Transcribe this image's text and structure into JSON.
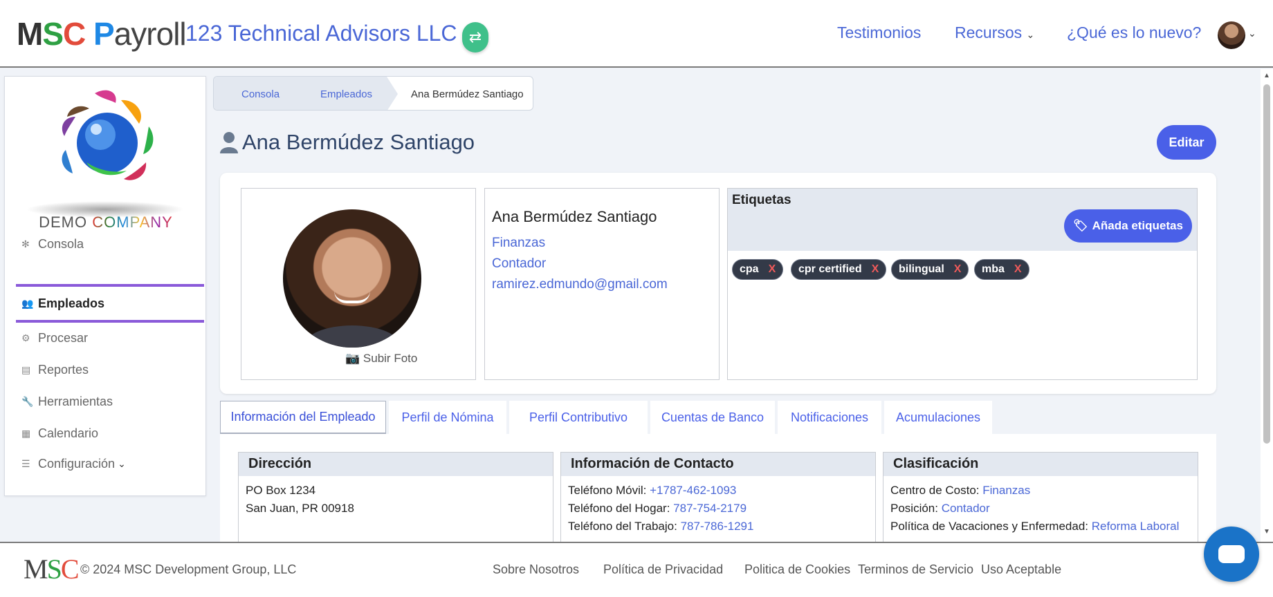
{
  "header": {
    "company": "123 Technical Advisors LLC",
    "nav": [
      {
        "label": "Testimonios"
      },
      {
        "label": "Recursos"
      },
      {
        "label": "¿Qué es lo nuevo?"
      }
    ]
  },
  "brand": {
    "logo_parts": [
      "M",
      "S",
      "C",
      "P",
      "ayroll"
    ],
    "demo_word1": "DEMO",
    "demo_word2": "COMPANY"
  },
  "sidebar": {
    "items": [
      {
        "label": "Consola",
        "icon": "gear-icon"
      },
      {
        "label": "Empleados",
        "icon": "users-icon"
      },
      {
        "label": "Procesar",
        "icon": "cogs-icon"
      },
      {
        "label": "Reportes",
        "icon": "printer-icon"
      },
      {
        "label": "Herramientas",
        "icon": "wrench-icon"
      },
      {
        "label": "Calendario",
        "icon": "calendar-icon"
      },
      {
        "label": "Configuración",
        "icon": "sliders-icon"
      }
    ]
  },
  "breadcrumb": {
    "items": [
      "Consola",
      "Empleados",
      "Ana Bermúdez Santiago"
    ]
  },
  "page": {
    "title": "Ana Bermúdez Santiago",
    "edit_label": "Editar"
  },
  "employee": {
    "name": "Ana Bermúdez Santiago",
    "department": "Finanzas",
    "position": "Contador",
    "email": "ramirez.edmundo@gmail.com",
    "upload_label": "Subir Foto"
  },
  "tags": {
    "title": "Etiquetas",
    "add_label": "Añada etiquetas",
    "items": [
      "cpa",
      "cpr certified",
      "bilingual",
      "mba"
    ],
    "remove_label": "X"
  },
  "tabs": [
    "Información del Empleado",
    "Perfil de Nómina",
    "Perfil Contributivo",
    "Cuentas de Banco",
    "Notificaciones",
    "Acumulaciones"
  ],
  "sections": {
    "direccion": {
      "title": "Dirección",
      "line1": "PO Box 1234",
      "line2": "San Juan, PR 00918"
    },
    "contacto": {
      "title": "Información de Contacto",
      "rows": [
        {
          "label": "Teléfono Móvil:",
          "value": "+1787-462-1093"
        },
        {
          "label": "Teléfono del Hogar:",
          "value": "787-754-2179"
        },
        {
          "label": "Teléfono del Trabajo:",
          "value": "787-786-1291"
        }
      ]
    },
    "clasificacion": {
      "title": "Clasificación",
      "rows": [
        {
          "label": "Centro de Costo:",
          "value": "Finanzas"
        },
        {
          "label": "Posición:",
          "value": "Contador"
        },
        {
          "label": "Política de Vacaciones y Enfermedad:",
          "value": "Reforma Laboral"
        }
      ]
    }
  },
  "footer": {
    "logo": "MSC",
    "copyright": "© 2024 MSC Development Group, LLC",
    "links": [
      "Sobre Nosotros",
      "Política de Privacidad",
      "Politica de Cookies",
      "Terminos de Servicio",
      "Uso Aceptable"
    ]
  },
  "colors": {
    "accent": "#4a60e8",
    "link": "#4a67d6",
    "active_indicator": "#8a5ad9",
    "switch": "#3fc08a",
    "tag_bg": "#333a48",
    "tag_remove": "#f05a5a"
  }
}
